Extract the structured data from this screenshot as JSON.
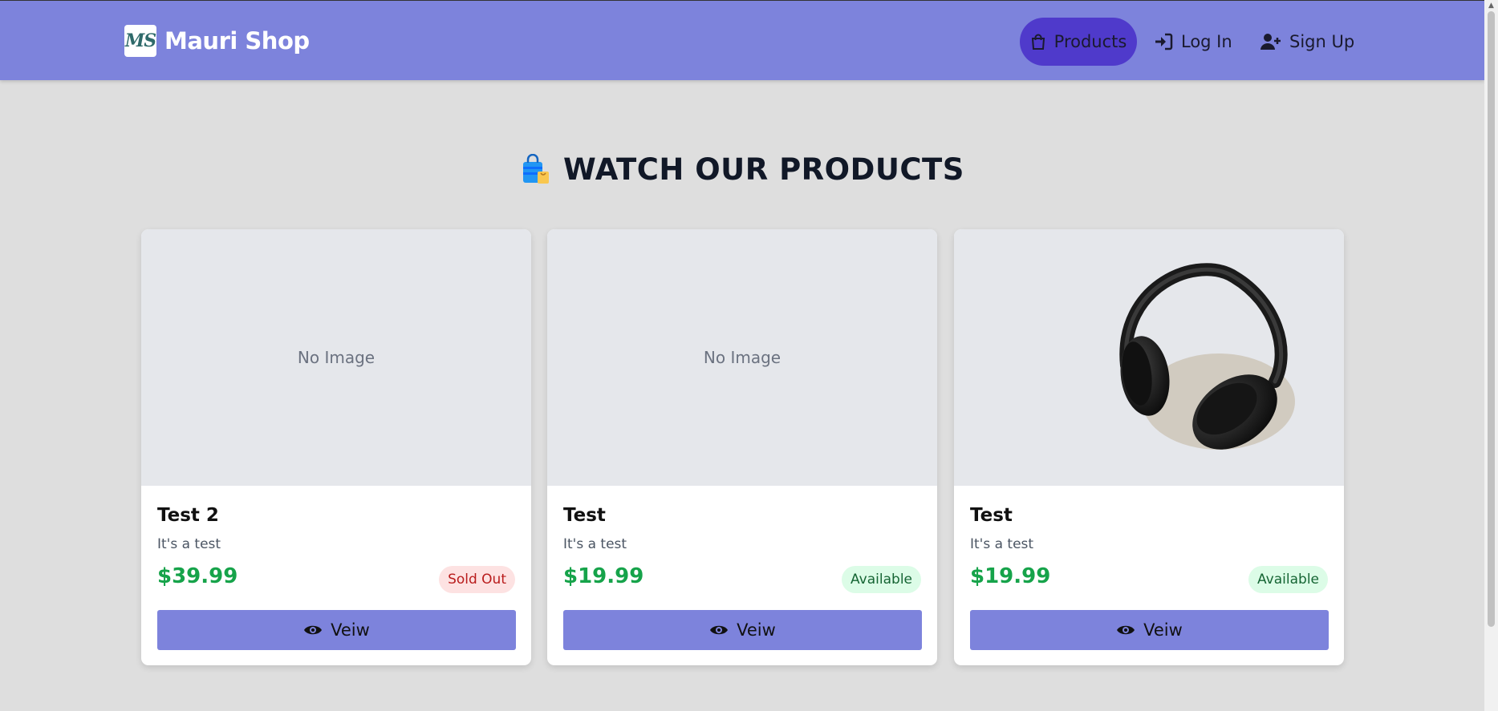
{
  "header": {
    "logo_text": "MS",
    "brand_name": "Mauri Shop",
    "nav": [
      {
        "label": "Products",
        "icon": "shopping-bag-icon",
        "active": true
      },
      {
        "label": "Log In",
        "icon": "login-icon",
        "active": false
      },
      {
        "label": "Sign Up",
        "icon": "user-plus-icon",
        "active": false
      }
    ]
  },
  "main": {
    "title": "WATCH OUR PRODUCTS",
    "title_icon": "shopping-bags-icon"
  },
  "products": [
    {
      "name": "Test 2",
      "description": "It's a test",
      "price": "$39.99",
      "status": "Sold Out",
      "image_placeholder": "No Image",
      "button": "Veiw"
    },
    {
      "name": "Test",
      "description": "It's a test",
      "price": "$19.99",
      "status": "Available",
      "image_placeholder": "No Image",
      "button": "Veiw"
    },
    {
      "name": "Test",
      "description": "It's a test",
      "price": "$19.99",
      "status": "Available",
      "image": "headphones-photo",
      "button": "Veiw"
    }
  ],
  "colors": {
    "navbar": "#7d83dc",
    "active_nav": "#4f3acb",
    "price": "#16a34a",
    "sold_out_bg": "#fde2e2",
    "available_bg": "#dcfce7",
    "button": "#7d83dc",
    "page_bg": "#dedede"
  }
}
